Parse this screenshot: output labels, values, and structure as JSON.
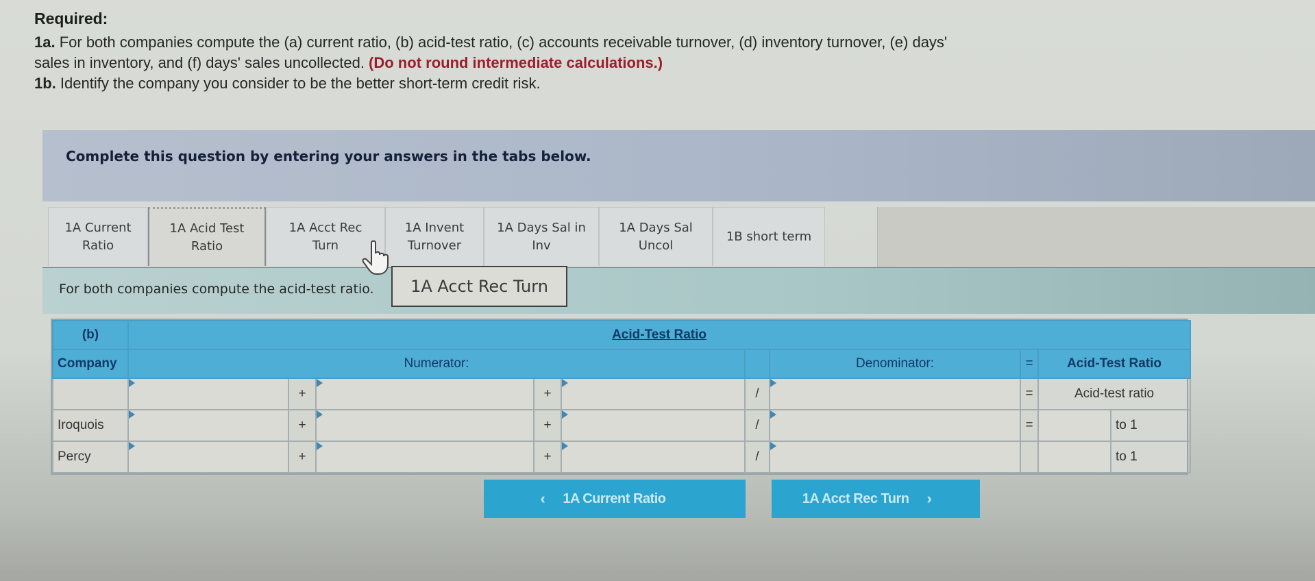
{
  "instructions": {
    "title": "Required:",
    "line1_label": "1a.",
    "line1_text": " For both companies compute the (a) current ratio, (b) acid-test ratio, (c) accounts receivable turnover, (d) inventory turnover, (e) days'",
    "line2_text": "sales in inventory, and (f) days' sales uncollected. ",
    "line2_warning": "(Do not round intermediate calculations.)",
    "line3_label": "1b.",
    "line3_text": " Identify the company you consider to be the better short-term credit risk."
  },
  "banner": {
    "text": "Complete this question by entering your answers in the tabs below."
  },
  "tabs": [
    {
      "line1": "1A Current",
      "line2": "Ratio"
    },
    {
      "line1": "1A Acid Test",
      "line2": "Ratio",
      "active": true
    },
    {
      "line1": "1A Acct Rec",
      "line2": "Turn"
    },
    {
      "line1": "1A Invent",
      "line2": "Turnover"
    },
    {
      "line1": "1A Days Sal in",
      "line2": "Inv"
    },
    {
      "line1": "1A Days Sal",
      "line2": "Uncol"
    },
    {
      "line1": "1B short term",
      "line2": ""
    }
  ],
  "content": {
    "description": "For both companies compute the acid-test ratio.",
    "tooltip": "1A Acct Rec Turn"
  },
  "table": {
    "part_label": "(b)",
    "title": "Acid-Test Ratio",
    "col_company": "Company",
    "col_numerator": "Numerator:",
    "col_denominator": "Denominator:",
    "col_equals": "=",
    "col_result": "Acid-Test Ratio",
    "op_plus": "+",
    "op_divide": "/",
    "op_equals": "=",
    "header_row_result": "Acid-test ratio",
    "rows": [
      {
        "company": "",
        "num1": "",
        "num2": "",
        "num3": "",
        "den": "",
        "result": "",
        "suffix": ""
      },
      {
        "company": "Iroquois",
        "num1": "",
        "num2": "",
        "num3": "",
        "den": "",
        "result": "",
        "suffix": "to 1"
      },
      {
        "company": "Percy",
        "num1": "",
        "num2": "",
        "num3": "",
        "den": "",
        "result": "",
        "suffix": "to 1"
      }
    ]
  },
  "navigation": {
    "prev_label": "1A Current Ratio",
    "next_label": "1A Acct Rec Turn",
    "prev_icon": "‹",
    "next_icon": "›"
  }
}
